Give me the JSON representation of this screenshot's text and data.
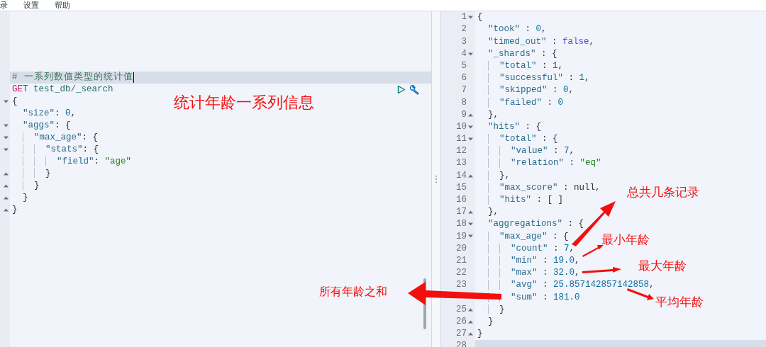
{
  "menu": [
    {
      "label": "录"
    },
    {
      "label": "设置"
    },
    {
      "label": "帮助"
    }
  ],
  "request_editor": {
    "lines": [
      {
        "active": true,
        "block_start": false,
        "block_end": false,
        "tokens": [
          {
            "kind": "comment",
            "text": "# 一系列数值类型的统计值"
          }
        ]
      },
      {
        "active": false,
        "block_start": false,
        "block_end": false,
        "tokens": [
          {
            "kind": "method",
            "text": "GET"
          },
          {
            "kind": "path",
            "text": " test_db/_search"
          }
        ]
      },
      {
        "active": false,
        "block_start": true,
        "block_end": false,
        "tokens": [
          {
            "kind": "punct",
            "text": "{"
          }
        ]
      },
      {
        "active": false,
        "block_start": false,
        "block_end": false,
        "tokens": [
          {
            "kind": "key",
            "text": "  \"size\""
          },
          {
            "kind": "punct",
            "text": ": "
          },
          {
            "kind": "number",
            "text": "0"
          },
          {
            "kind": "punct",
            "text": ","
          }
        ]
      },
      {
        "active": false,
        "block_start": true,
        "block_end": false,
        "tokens": [
          {
            "kind": "key",
            "text": "  \"aggs\""
          },
          {
            "kind": "punct",
            "text": ": {"
          }
        ]
      },
      {
        "active": false,
        "block_start": true,
        "block_end": false,
        "tokens": [
          {
            "kind": "key",
            "text": "    \"max_age\""
          },
          {
            "kind": "punct",
            "text": ": {"
          }
        ]
      },
      {
        "active": false,
        "block_start": true,
        "block_end": false,
        "tokens": [
          {
            "kind": "key",
            "text": "      \"stats\""
          },
          {
            "kind": "punct",
            "text": ": {"
          }
        ]
      },
      {
        "active": false,
        "block_start": false,
        "block_end": false,
        "tokens": [
          {
            "kind": "key",
            "text": "        \"field\""
          },
          {
            "kind": "punct",
            "text": ": "
          },
          {
            "kind": "string",
            "text": "\"age\""
          }
        ]
      },
      {
        "active": false,
        "block_start": false,
        "block_end": true,
        "tokens": [
          {
            "kind": "punct",
            "text": "      }"
          }
        ]
      },
      {
        "active": false,
        "block_start": false,
        "block_end": true,
        "tokens": [
          {
            "kind": "punct",
            "text": "    }"
          }
        ]
      },
      {
        "active": false,
        "block_start": false,
        "block_end": true,
        "tokens": [
          {
            "kind": "punct",
            "text": "  }"
          }
        ]
      },
      {
        "active": false,
        "block_start": false,
        "block_end": true,
        "tokens": [
          {
            "kind": "punct",
            "text": "}"
          }
        ]
      }
    ]
  },
  "splitter": {
    "handle": "⋮"
  },
  "response_viewer": {
    "lines": [
      {
        "number": "1",
        "active": false,
        "block_start": true,
        "block_end": false,
        "tokens": [
          {
            "kind": "punct",
            "text": "{"
          }
        ]
      },
      {
        "number": "2",
        "active": false,
        "block_start": false,
        "block_end": false,
        "tokens": [
          {
            "kind": "key",
            "text": "  \"took\""
          },
          {
            "kind": "punct",
            "text": " : "
          },
          {
            "kind": "number",
            "text": "0"
          },
          {
            "kind": "punct",
            "text": ","
          }
        ]
      },
      {
        "number": "3",
        "active": false,
        "block_start": false,
        "block_end": false,
        "tokens": [
          {
            "kind": "key",
            "text": "  \"timed_out\""
          },
          {
            "kind": "punct",
            "text": " : "
          },
          {
            "kind": "bool",
            "text": "false"
          },
          {
            "kind": "punct",
            "text": ","
          }
        ]
      },
      {
        "number": "4",
        "active": false,
        "block_start": true,
        "block_end": false,
        "tokens": [
          {
            "kind": "key",
            "text": "  \"_shards\""
          },
          {
            "kind": "punct",
            "text": " : {"
          }
        ]
      },
      {
        "number": "5",
        "active": false,
        "block_start": false,
        "block_end": false,
        "tokens": [
          {
            "kind": "key",
            "text": "    \"total\""
          },
          {
            "kind": "punct",
            "text": " : "
          },
          {
            "kind": "number",
            "text": "1"
          },
          {
            "kind": "punct",
            "text": ","
          }
        ]
      },
      {
        "number": "6",
        "active": false,
        "block_start": false,
        "block_end": false,
        "tokens": [
          {
            "kind": "key",
            "text": "    \"successful\""
          },
          {
            "kind": "punct",
            "text": " : "
          },
          {
            "kind": "number",
            "text": "1"
          },
          {
            "kind": "punct",
            "text": ","
          }
        ]
      },
      {
        "number": "7",
        "active": false,
        "block_start": false,
        "block_end": false,
        "tokens": [
          {
            "kind": "key",
            "text": "    \"skipped\""
          },
          {
            "kind": "punct",
            "text": " : "
          },
          {
            "kind": "number",
            "text": "0"
          },
          {
            "kind": "punct",
            "text": ","
          }
        ]
      },
      {
        "number": "8",
        "active": false,
        "block_start": false,
        "block_end": false,
        "tokens": [
          {
            "kind": "key",
            "text": "    \"failed\""
          },
          {
            "kind": "punct",
            "text": " : "
          },
          {
            "kind": "number",
            "text": "0"
          }
        ]
      },
      {
        "number": "9",
        "active": false,
        "block_start": false,
        "block_end": true,
        "tokens": [
          {
            "kind": "punct",
            "text": "  },"
          }
        ]
      },
      {
        "number": "10",
        "active": false,
        "block_start": true,
        "block_end": false,
        "tokens": [
          {
            "kind": "key",
            "text": "  \"hits\""
          },
          {
            "kind": "punct",
            "text": " : {"
          }
        ]
      },
      {
        "number": "11",
        "active": false,
        "block_start": true,
        "block_end": false,
        "tokens": [
          {
            "kind": "key",
            "text": "    \"total\""
          },
          {
            "kind": "punct",
            "text": " : {"
          }
        ]
      },
      {
        "number": "12",
        "active": false,
        "block_start": false,
        "block_end": false,
        "tokens": [
          {
            "kind": "key",
            "text": "      \"value\""
          },
          {
            "kind": "punct",
            "text": " : "
          },
          {
            "kind": "number",
            "text": "7"
          },
          {
            "kind": "punct",
            "text": ","
          }
        ]
      },
      {
        "number": "13",
        "active": false,
        "block_start": false,
        "block_end": false,
        "tokens": [
          {
            "kind": "key",
            "text": "      \"relation\""
          },
          {
            "kind": "punct",
            "text": " : "
          },
          {
            "kind": "string",
            "text": "\"eq\""
          }
        ]
      },
      {
        "number": "14",
        "active": false,
        "block_start": false,
        "block_end": true,
        "tokens": [
          {
            "kind": "punct",
            "text": "    },"
          }
        ]
      },
      {
        "number": "15",
        "active": false,
        "block_start": false,
        "block_end": false,
        "tokens": [
          {
            "kind": "key",
            "text": "    \"max_score\""
          },
          {
            "kind": "punct",
            "text": " : "
          },
          {
            "kind": "null",
            "text": "null"
          },
          {
            "kind": "punct",
            "text": ","
          }
        ]
      },
      {
        "number": "16",
        "active": false,
        "block_start": false,
        "block_end": false,
        "tokens": [
          {
            "kind": "key",
            "text": "    \"hits\""
          },
          {
            "kind": "punct",
            "text": " : [ ]"
          }
        ]
      },
      {
        "number": "17",
        "active": false,
        "block_start": false,
        "block_end": true,
        "tokens": [
          {
            "kind": "punct",
            "text": "  },"
          }
        ]
      },
      {
        "number": "18",
        "active": false,
        "block_start": true,
        "block_end": false,
        "tokens": [
          {
            "kind": "key",
            "text": "  \"aggregations\""
          },
          {
            "kind": "punct",
            "text": " : {"
          }
        ]
      },
      {
        "number": "19",
        "active": false,
        "block_start": true,
        "block_end": false,
        "tokens": [
          {
            "kind": "key",
            "text": "    \"max_age\""
          },
          {
            "kind": "punct",
            "text": " : {"
          }
        ]
      },
      {
        "number": "20",
        "active": false,
        "block_start": false,
        "block_end": false,
        "tokens": [
          {
            "kind": "key",
            "text": "      \"count\""
          },
          {
            "kind": "punct",
            "text": " : "
          },
          {
            "kind": "number",
            "text": "7"
          },
          {
            "kind": "punct",
            "text": ","
          }
        ]
      },
      {
        "number": "21",
        "active": false,
        "block_start": false,
        "block_end": false,
        "tokens": [
          {
            "kind": "key",
            "text": "      \"min\""
          },
          {
            "kind": "punct",
            "text": " : "
          },
          {
            "kind": "number",
            "text": "19.0"
          },
          {
            "kind": "punct",
            "text": ","
          }
        ]
      },
      {
        "number": "22",
        "active": false,
        "block_start": false,
        "block_end": false,
        "tokens": [
          {
            "kind": "key",
            "text": "      \"max\""
          },
          {
            "kind": "punct",
            "text": " : "
          },
          {
            "kind": "number",
            "text": "32.0"
          },
          {
            "kind": "punct",
            "text": ","
          }
        ]
      },
      {
        "number": "23",
        "active": false,
        "block_start": false,
        "block_end": false,
        "tokens": [
          {
            "kind": "key",
            "text": "      \"avg\""
          },
          {
            "kind": "punct",
            "text": " : "
          },
          {
            "kind": "number",
            "text": "25.857142857142858"
          },
          {
            "kind": "punct",
            "text": ","
          }
        ]
      },
      {
        "active": false,
        "block_start": false,
        "block_end": false,
        "tokens": [
          {
            "kind": "key",
            "text": "      \"sum\""
          },
          {
            "kind": "punct",
            "text": " : "
          },
          {
            "kind": "number",
            "text": "181.0"
          }
        ]
      },
      {
        "number": "25",
        "active": false,
        "block_start": false,
        "block_end": true,
        "tokens": [
          {
            "kind": "punct",
            "text": "    }"
          }
        ]
      },
      {
        "number": "26",
        "active": false,
        "block_start": false,
        "block_end": true,
        "tokens": [
          {
            "kind": "punct",
            "text": "  }"
          }
        ]
      },
      {
        "number": "27",
        "active": false,
        "block_start": false,
        "block_end": true,
        "tokens": [
          {
            "kind": "punct",
            "text": "}"
          }
        ]
      },
      {
        "number": "28",
        "active": true,
        "block_start": false,
        "block_end": false
      }
    ]
  },
  "annotations": [
    {
      "text": "统计年龄一系列信息"
    },
    {
      "text": "总共几条记录"
    },
    {
      "text": "最小年龄"
    },
    {
      "text": "最大年龄"
    },
    {
      "text": "平均年龄"
    },
    {
      "text": "所有年龄之和"
    }
  ]
}
